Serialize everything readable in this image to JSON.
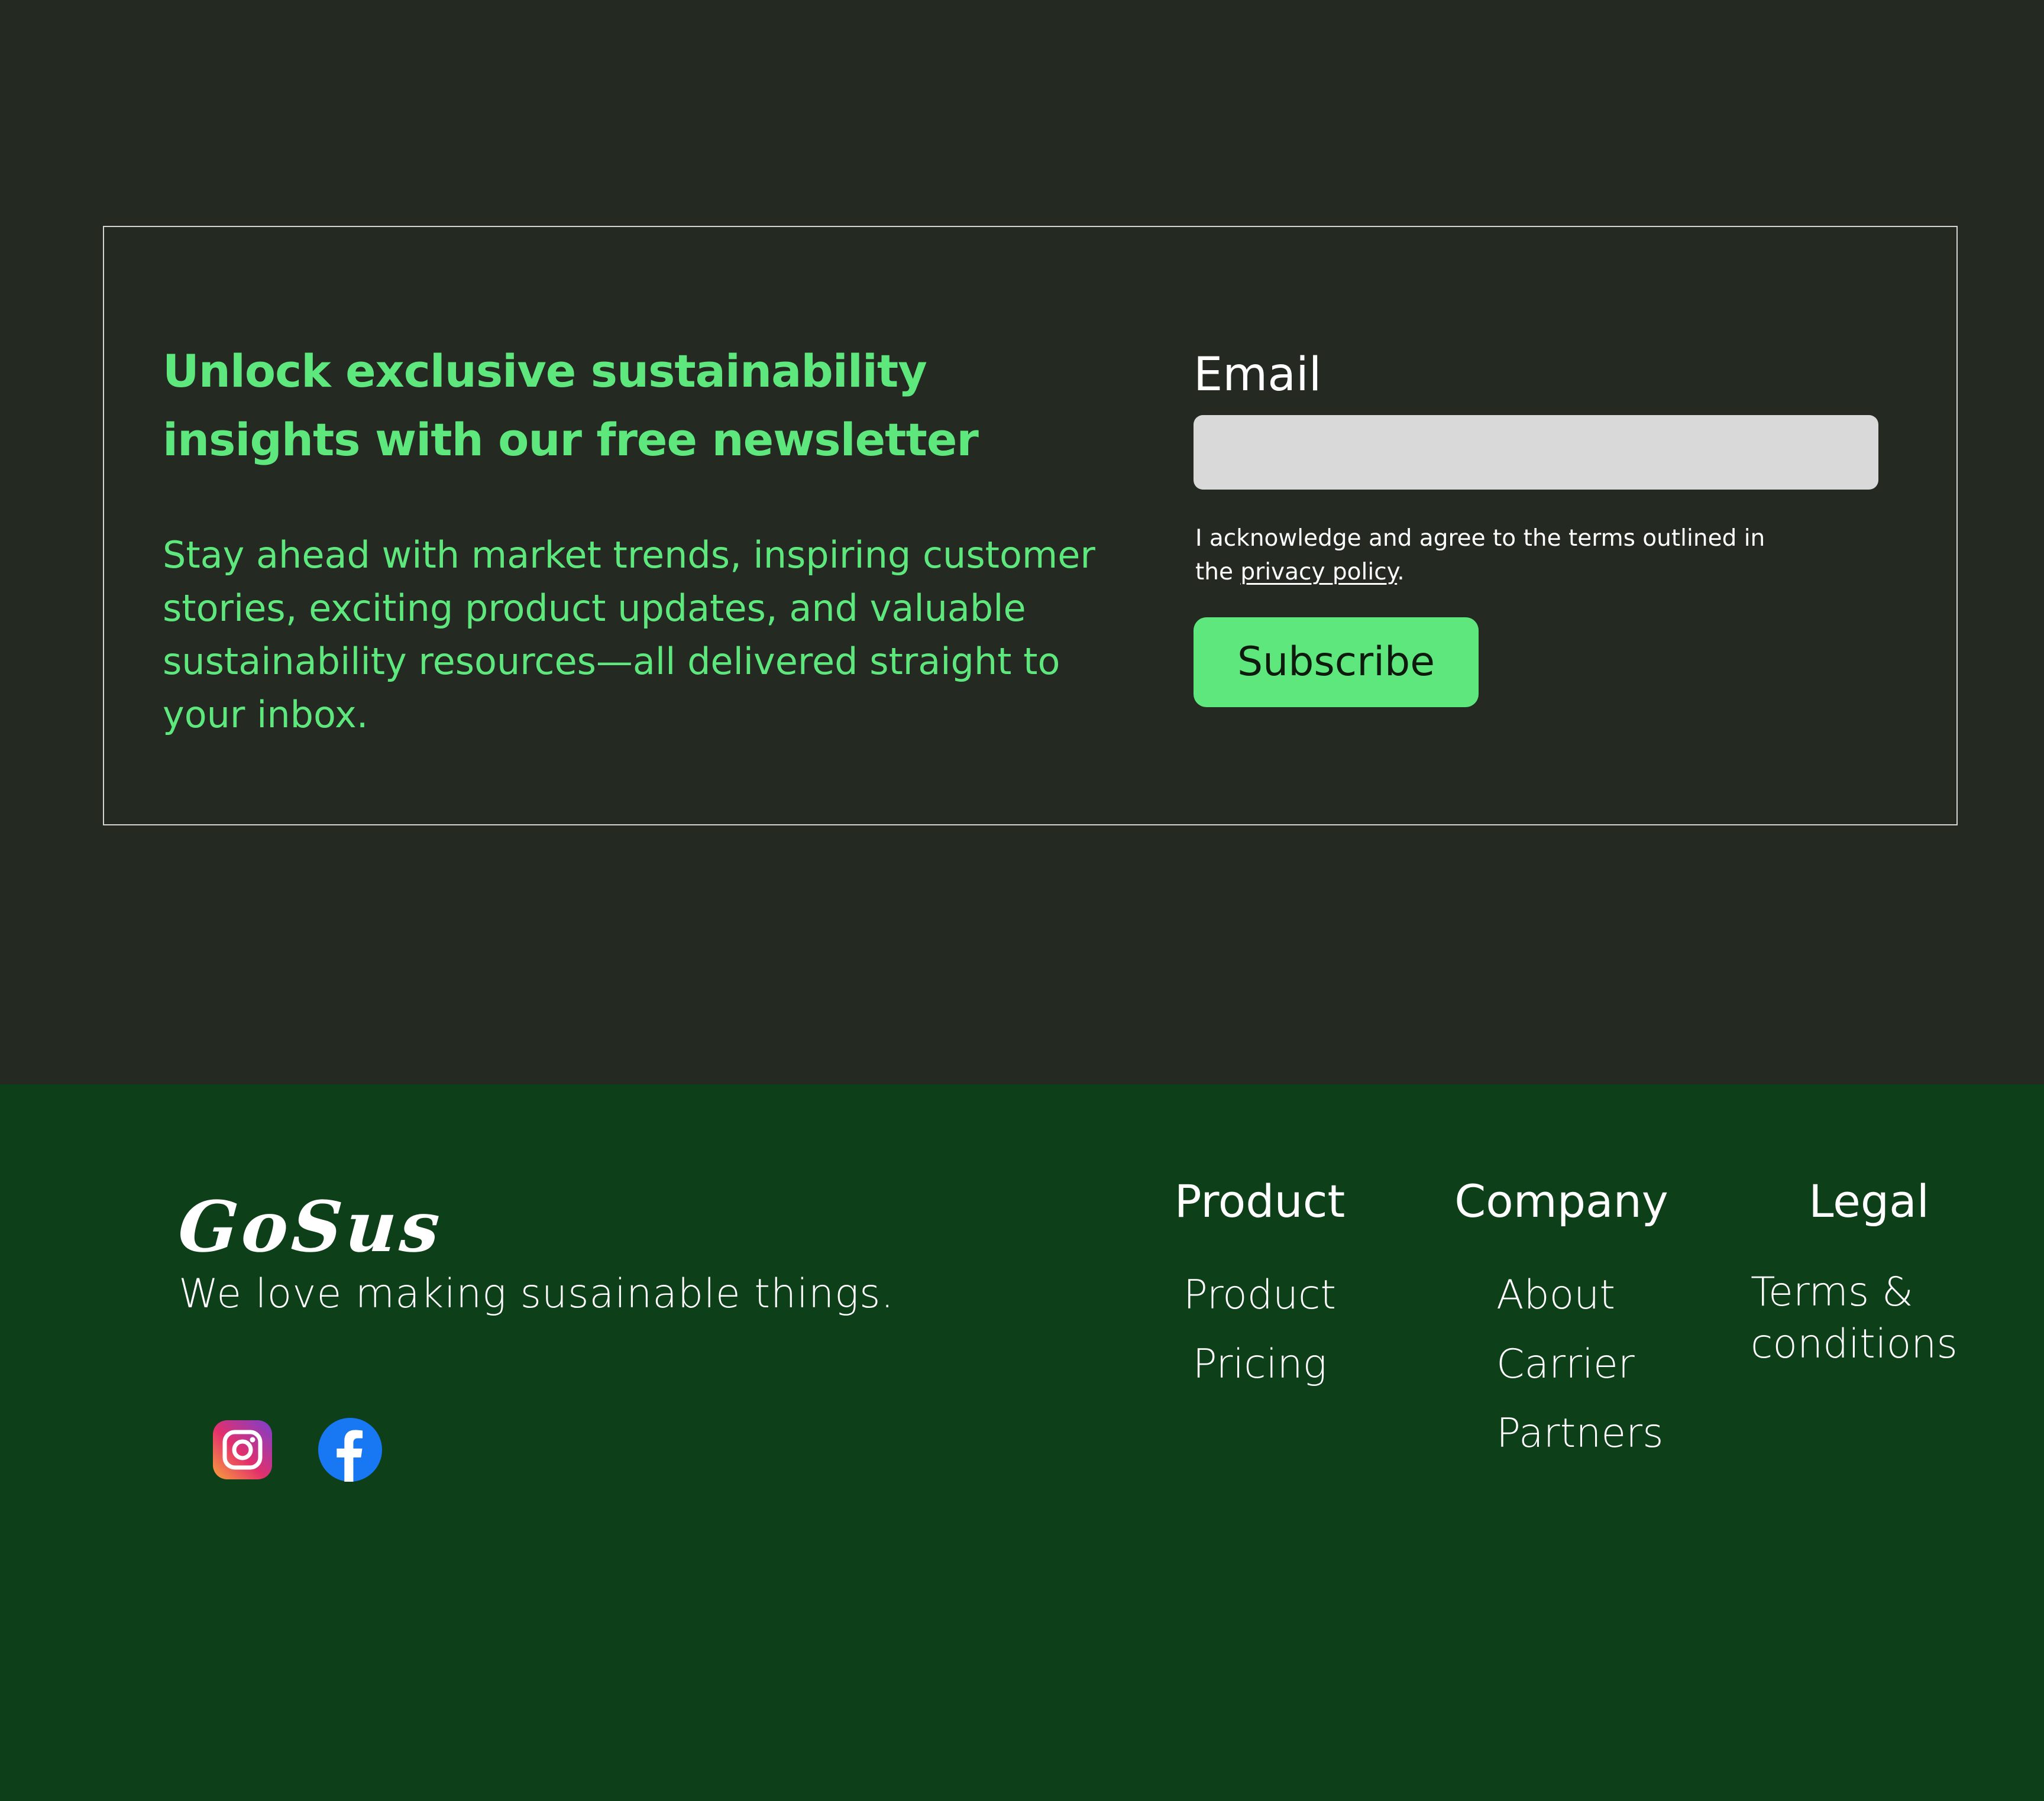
{
  "newsletter": {
    "heading": "Unlock exclusive sustainability insights with our free newsletter",
    "body": "Stay ahead with market trends, inspiring customer stories, exciting product updates, and valuable sustainability resources—all delivered straight to your inbox.",
    "email_label": "Email",
    "email_value": "",
    "email_placeholder": "",
    "consent_prefix": "I acknowledge and agree to the terms outlined in the ",
    "consent_link": "privacy policy",
    "consent_suffix": ".",
    "subscribe_label": "Subscribe",
    "colors": {
      "accent": "#5ee77c",
      "background": "#242922",
      "input_background": "#d9d9d9"
    }
  },
  "footer": {
    "logo": "GoSus",
    "tagline": "We love making susainable things.",
    "social": [
      {
        "icon": "instagram-icon"
      },
      {
        "icon": "facebook-icon"
      }
    ],
    "columns": [
      {
        "title": "Product",
        "links": [
          "Product",
          "Pricing"
        ]
      },
      {
        "title": "Company",
        "links": [
          "About",
          "Carrier",
          "Partners"
        ]
      },
      {
        "title": "Legal",
        "links": [
          "Terms & conditions"
        ]
      }
    ],
    "colors": {
      "background": "#0d3f19",
      "text": "#ffffff"
    }
  }
}
